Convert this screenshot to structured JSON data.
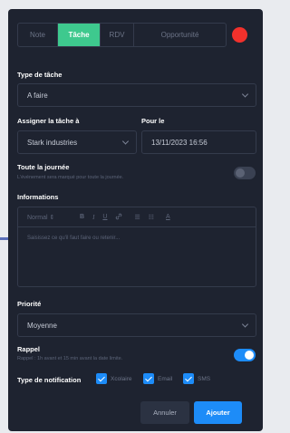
{
  "tabs": [
    {
      "label": "Note"
    },
    {
      "label": "Tâche"
    },
    {
      "label": "RDV"
    },
    {
      "label": "Opportunité"
    }
  ],
  "active_tab": "Tâche",
  "colors": {
    "accent": "#1d8cf8",
    "active_tab": "#3ec98e",
    "color_dot": "#f2312c",
    "modal_bg": "#1e2330"
  },
  "task_type": {
    "label": "Type de tâche",
    "value": "A faire"
  },
  "assign": {
    "label": "Assigner la tâche à",
    "value": "Stark industries"
  },
  "due": {
    "label": "Pour le",
    "value": "13/11/2023 16:56"
  },
  "all_day": {
    "label": "Toute la journée",
    "hint": "L'événement sera marqué pour toute la journée.",
    "enabled": false
  },
  "info": {
    "label": "Informations",
    "toolbar": {
      "format": "Normal",
      "format_arrow": "⇕",
      "bold": "B",
      "italic": "I",
      "underline": "U",
      "link": "🔗",
      "ordered": "☰",
      "bullet": "☷",
      "color": "A"
    },
    "placeholder": "Saisissez ce qu'il faut faire ou retenir..."
  },
  "priority": {
    "label": "Priorité",
    "value": "Moyenne"
  },
  "reminder": {
    "label": "Rappel",
    "hint": "Rappel : 1h avant et 15 min avant la date limite.",
    "enabled": true
  },
  "notification": {
    "label": "Type de notification",
    "options": [
      {
        "label": "Xcolaire",
        "checked": true
      },
      {
        "label": "Email",
        "checked": true
      },
      {
        "label": "SMS",
        "checked": true
      }
    ]
  },
  "actions": {
    "cancel": "Annuler",
    "submit": "Ajouter"
  }
}
